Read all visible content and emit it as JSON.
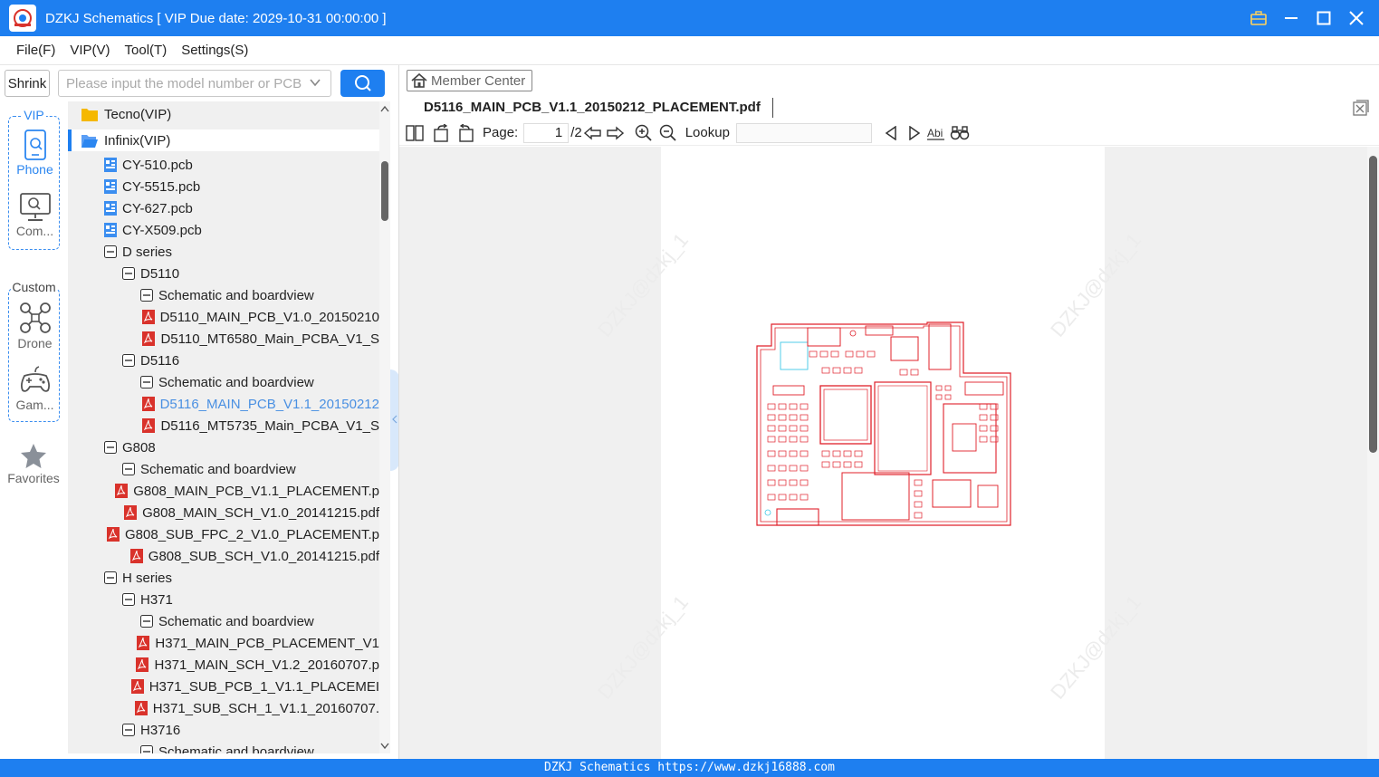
{
  "window": {
    "title": "DZKJ Schematics [ VIP Due date: 2029-10-31 00:00:00 ]"
  },
  "menu": [
    "File(F)",
    "VIP(V)",
    "Tool(T)",
    "Settings(S)"
  ],
  "rail": {
    "shrink_label": "Shrink",
    "vip_label": "VIP",
    "phone_label": "Phone",
    "computer_label": "Com...",
    "custom_label": "Custom",
    "drone_label": "Drone",
    "game_label": "Gam...",
    "favorites_label": "Favorites"
  },
  "search": {
    "placeholder": "Please input the model number or PCB"
  },
  "tree": [
    {
      "indent": 0,
      "icon": "folder",
      "label": "Tecno(VIP)"
    },
    {
      "indent": 0,
      "icon": "folder-open",
      "label": "Infinix(VIP)",
      "selected": true
    },
    {
      "indent": 2,
      "icon": "pcb",
      "label": "CY-510.pcb"
    },
    {
      "indent": 2,
      "icon": "pcb",
      "label": "CY-5515.pcb"
    },
    {
      "indent": 2,
      "icon": "pcb",
      "label": "CY-627.pcb"
    },
    {
      "indent": 2,
      "icon": "pcb",
      "label": "CY-X509.pcb"
    },
    {
      "indent": 2,
      "icon": "minus",
      "label": "D series"
    },
    {
      "indent": 3,
      "icon": "minus",
      "label": "D5110"
    },
    {
      "indent": 4,
      "icon": "minus",
      "label": "Schematic and boardview"
    },
    {
      "indent": 5,
      "icon": "pdf",
      "label": "D5110_MAIN_PCB_V1.0_20150210"
    },
    {
      "indent": 5,
      "icon": "pdf",
      "label": "D5110_MT6580_Main_PCBA_V1_S"
    },
    {
      "indent": 3,
      "icon": "minus",
      "label": "D5116"
    },
    {
      "indent": 4,
      "icon": "minus",
      "label": "Schematic and boardview"
    },
    {
      "indent": 5,
      "icon": "pdf",
      "label": "D5116_MAIN_PCB_V1.1_20150212",
      "highlight": true
    },
    {
      "indent": 5,
      "icon": "pdf",
      "label": "D5116_MT5735_Main_PCBA_V1_S"
    },
    {
      "indent": 2,
      "icon": "minus",
      "label": "G808"
    },
    {
      "indent": 3,
      "icon": "minus",
      "label": "Schematic and boardview"
    },
    {
      "indent": 4,
      "icon": "pdf",
      "label": "G808_MAIN_PCB_V1.1_PLACEMENT.p"
    },
    {
      "indent": 4,
      "icon": "pdf",
      "label": "G808_MAIN_SCH_V1.0_20141215.pdf"
    },
    {
      "indent": 4,
      "icon": "pdf",
      "label": "G808_SUB_FPC_2_V1.0_PLACEMENT.p"
    },
    {
      "indent": 4,
      "icon": "pdf",
      "label": "G808_SUB_SCH_V1.0_20141215.pdf"
    },
    {
      "indent": 2,
      "icon": "minus",
      "label": "H series"
    },
    {
      "indent": 3,
      "icon": "minus",
      "label": "H371"
    },
    {
      "indent": 4,
      "icon": "minus",
      "label": "Schematic and boardview"
    },
    {
      "indent": 5,
      "icon": "pdf",
      "label": "H371_MAIN_PCB_PLACEMENT_V1"
    },
    {
      "indent": 5,
      "icon": "pdf",
      "label": "H371_MAIN_SCH_V1.2_20160707.p"
    },
    {
      "indent": 5,
      "icon": "pdf",
      "label": "H371_SUB_PCB_1_V1.1_PLACEMEI"
    },
    {
      "indent": 5,
      "icon": "pdf",
      "label": "H371_SUB_SCH_1_V1.1_20160707."
    },
    {
      "indent": 3,
      "icon": "minus",
      "label": "H3716"
    },
    {
      "indent": 4,
      "icon": "minus",
      "label": "Schematic and boardview"
    }
  ],
  "viewer": {
    "member_center": "Member Center",
    "doc_tab": "D5116_MAIN_PCB_V1.1_20150212_PLACEMENT.pdf",
    "page_label": "Page:",
    "page_current": "1",
    "page_total": "/2",
    "lookup_label": "Lookup",
    "watermark": "DZKJ@dzkj_1"
  },
  "status": {
    "text": "DZKJ Schematics https://www.dzkj16888.com"
  },
  "colors": {
    "accent": "#1e7ff0",
    "pdf_icon": "#d9322b",
    "pcb_icon": "#3b8ef0",
    "folder": "#f5b800",
    "board_trace": "#e0202a"
  }
}
